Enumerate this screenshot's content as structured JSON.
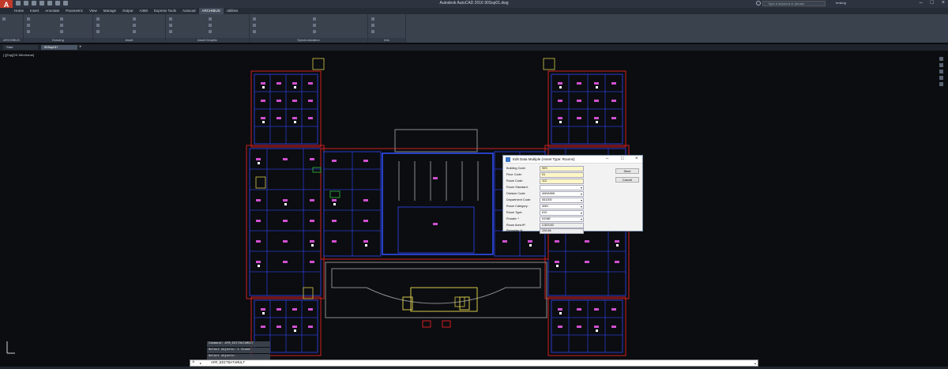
{
  "titlebar": {
    "app_logo": "A",
    "title": "Autodesk AutoCAD 2016    90Ssp01.dwg",
    "search_placeholder": "Type a keyword or phrase",
    "user": "bmking",
    "minimize": "–",
    "maximize": "□",
    "close": "×"
  },
  "ribbon": {
    "tabs": [
      "Home",
      "Insert",
      "Annotate",
      "Parametric",
      "View",
      "Manage",
      "Output",
      "A360",
      "Express Tools",
      "Autocad",
      "ARCHIBUS",
      "Utilities"
    ],
    "active_tab": "ARCHIBUS",
    "panels": [
      "ARCHIBUS",
      "Drawing",
      "Asset",
      "Asset Graphic",
      "Synchronization",
      "Info"
    ]
  },
  "doc_tabs": {
    "tabs": [
      "Start",
      "90Ssp01*"
    ],
    "active": "90Ssp01*",
    "add_label": "+"
  },
  "viewport": {
    "label": "[-][Top][2D Wireframe]"
  },
  "dialog": {
    "title": "Edit Data Multiple (Asset Type: Rooms)",
    "minimize": "–",
    "maximize": "□",
    "close": "×",
    "fields": [
      {
        "label": "Building Code:",
        "value": "90S",
        "style": "yellow"
      },
      {
        "label": "Floor Code:",
        "value": "01",
        "style": "yellow"
      },
      {
        "label": "Room Code:",
        "value": "112",
        "style": "yellow"
      },
      {
        "label": "Room Standard:",
        "value": "",
        "style": "dropdown"
      },
      {
        "label": "Division Code:",
        "value": "ANNNNN",
        "style": "dropdown"
      },
      {
        "label": "Department Code:",
        "value": "061000",
        "style": "dropdown"
      },
      {
        "label": "Room Category:",
        "value": "ANN",
        "style": "dropdown"
      },
      {
        "label": "Room Type:",
        "value": "610",
        "style": "dropdown"
      },
      {
        "label": "Prorate: *",
        "value": "NONE",
        "style": "dropdown"
      },
      {
        "label": "Room Area ft²:",
        "value": "2,503.83",
        "style": "gray"
      },
      {
        "label": "Perimeter ft:",
        "value": "226.86",
        "style": "gray"
      }
    ],
    "save_label": "Save",
    "cancel_label": "Cancel"
  },
  "command": {
    "history": [
      "Command: AFM_EDITDATAMULT",
      "Select objects: 1 found",
      "Select objects:"
    ],
    "current": "AFM_EDITDATAMULT"
  },
  "colors": {
    "wall_outer": "#d02020",
    "wall_inner": "#2a3acc",
    "label_magenta": "#d050d0",
    "accent": "#3b78c7"
  }
}
